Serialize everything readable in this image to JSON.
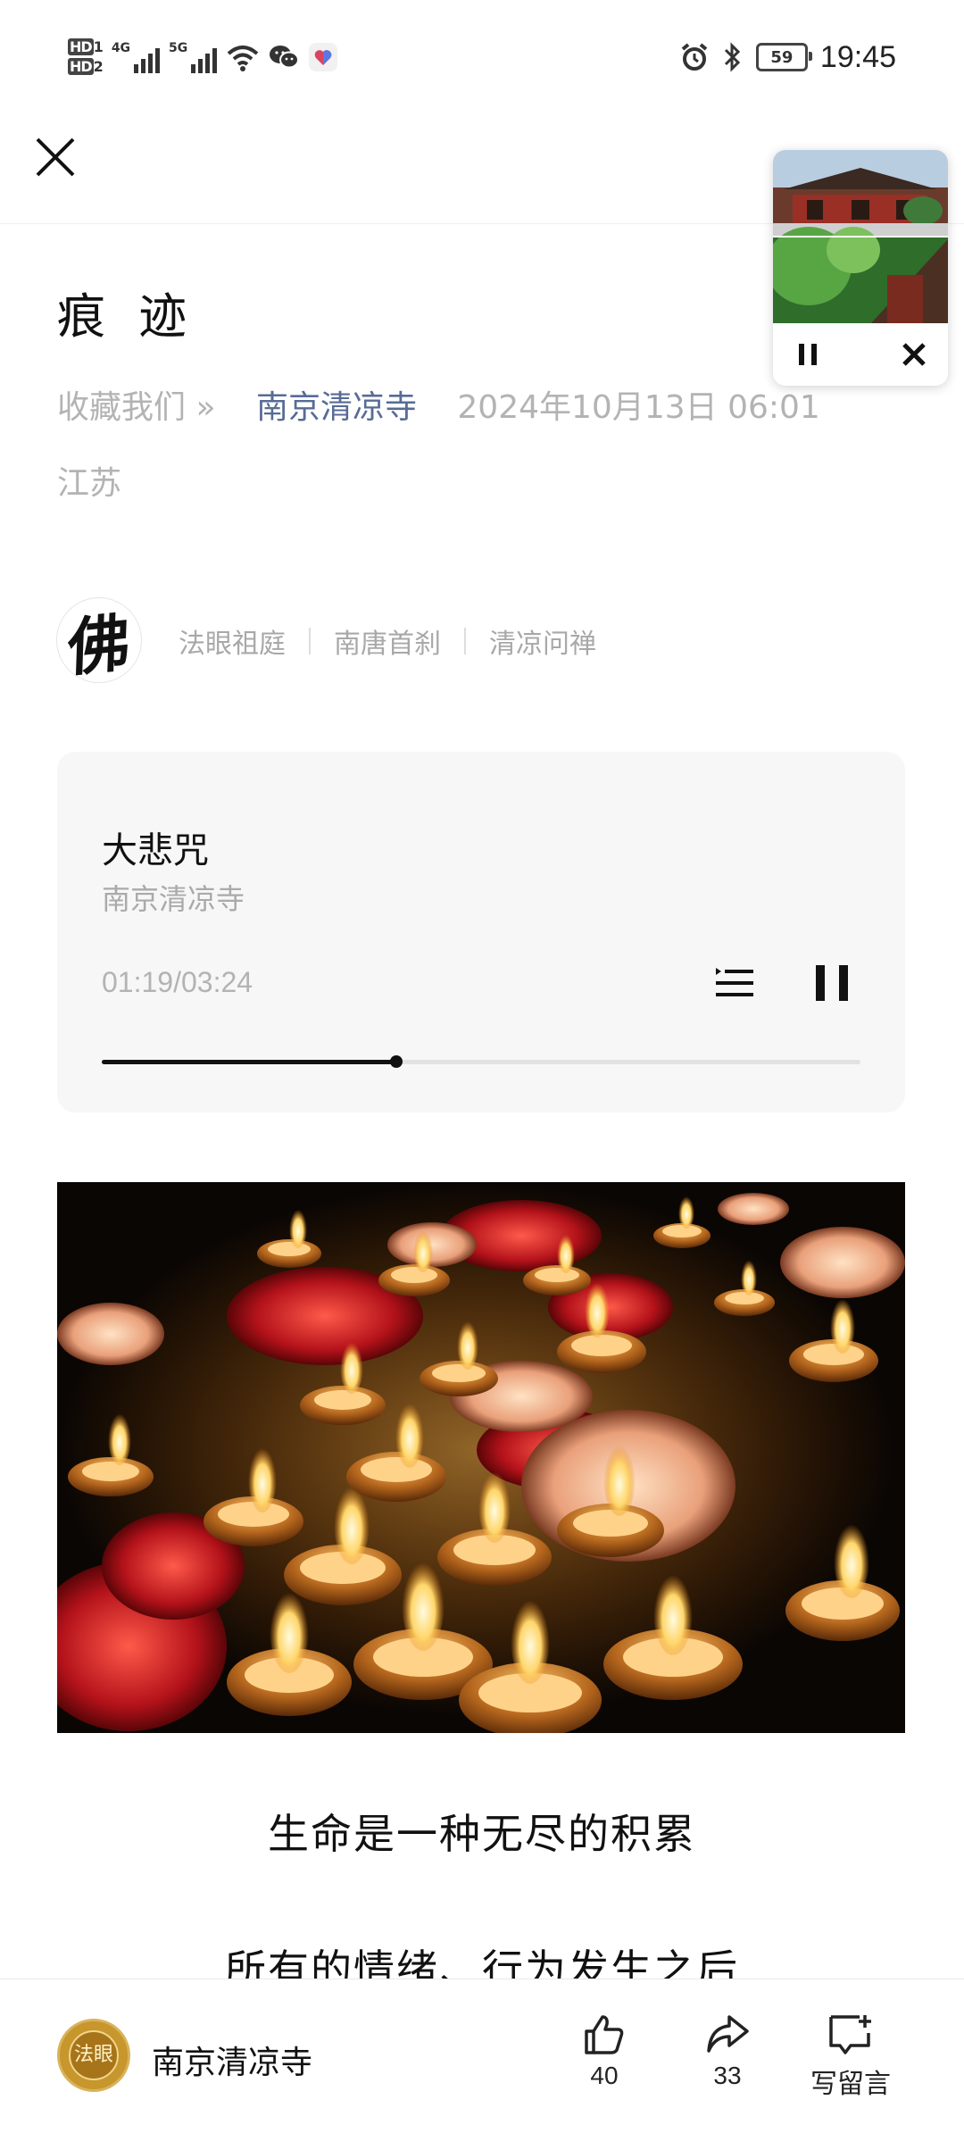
{
  "status_bar": {
    "hd1": "HD",
    "hd1_sub": "1",
    "hd2": "HD",
    "hd2_sub": "2",
    "net1": "4G",
    "net2": "5G",
    "battery": "59",
    "time": "19:45"
  },
  "article": {
    "title": "痕 迹",
    "favorite": "收藏我们 »",
    "account": "南京清凉寺",
    "date": "2024年10月13日 06:01",
    "region": "江苏",
    "avatar_char": "佛",
    "tags": [
      "法眼祖庭",
      "南唐首刹",
      "清凉问禅"
    ]
  },
  "audio_player": {
    "title": "大悲咒",
    "artist": "南京清凉寺",
    "time": "01:19/03:24",
    "progress": 0.388
  },
  "body": {
    "line1": "生命是一种无尽的积累",
    "line2": "所有的情绪、行为发生之后"
  },
  "bottom_bar": {
    "account": "南京清凉寺",
    "logo_text": "法眼",
    "likes": "40",
    "shares": "33",
    "comment": "写留言"
  },
  "colors": {
    "account_link": "#576b95",
    "meta_gray": "#b3b3b3"
  }
}
